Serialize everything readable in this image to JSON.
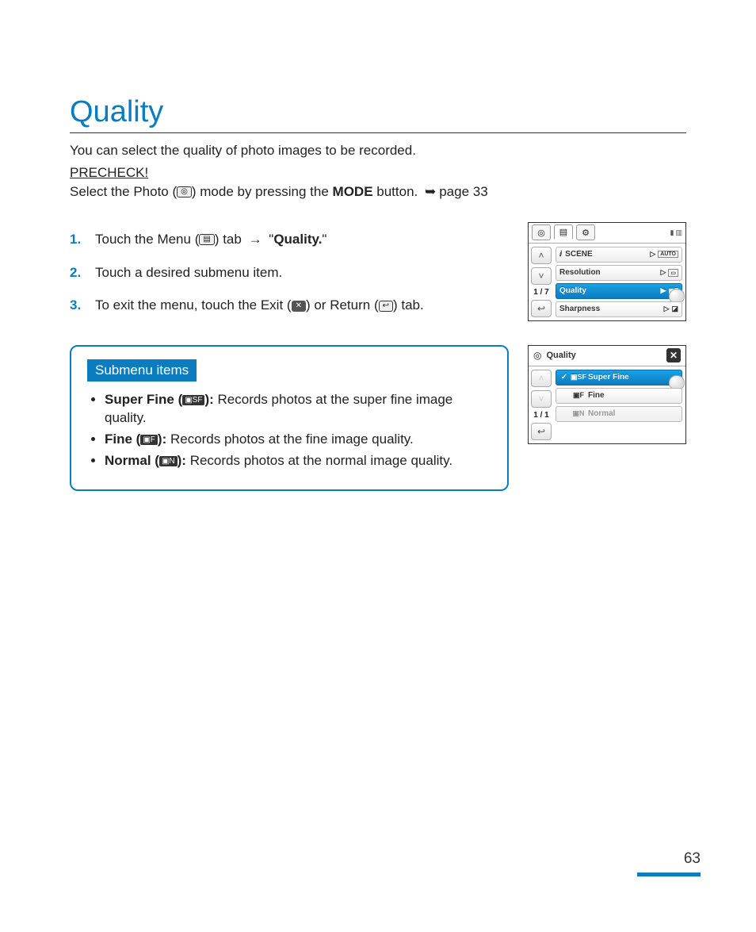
{
  "page": {
    "number": "63"
  },
  "title": "Quality",
  "intro": "You can select the quality of photo images to be recorded.",
  "precheck": {
    "label": "PRECHECK!",
    "text_before": "Select the Photo (",
    "text_mid": ") mode by pressing the ",
    "mode_bold": "MODE",
    "text_after": " button. ",
    "page_ref": "page 33"
  },
  "steps": {
    "s1": {
      "num": "1.",
      "a": "Touch the Menu (",
      "b": ") tab ",
      "c": " \"",
      "bold": "Quality.",
      "d": "\""
    },
    "s2": {
      "num": "2.",
      "text": "Touch a desired submenu item."
    },
    "s3": {
      "num": "3.",
      "a": "To exit the menu, touch the Exit (",
      "b": ") or Return (",
      "c": ") tab."
    }
  },
  "screen1": {
    "page_indicator": "1 / 7",
    "items": {
      "scene": "SCENE",
      "resolution": "Resolution",
      "quality": "Quality",
      "sharpness": "Sharpness"
    }
  },
  "screen2": {
    "title": "Quality",
    "page_indicator": "1 / 1",
    "options": {
      "superfine": "Super Fine",
      "fine": "Fine",
      "normal": "Normal"
    }
  },
  "submenu": {
    "label": "Submenu items",
    "items": {
      "sf": {
        "name": "Super Fine (",
        "close": "):",
        "desc": " Records photos at the super fine image quality."
      },
      "f": {
        "name": "Fine (",
        "close": "):",
        "desc": " Records photos at the fine image quality."
      },
      "n": {
        "name": "Normal (",
        "close": "):",
        "desc": " Records photos at the normal image quality."
      }
    }
  }
}
